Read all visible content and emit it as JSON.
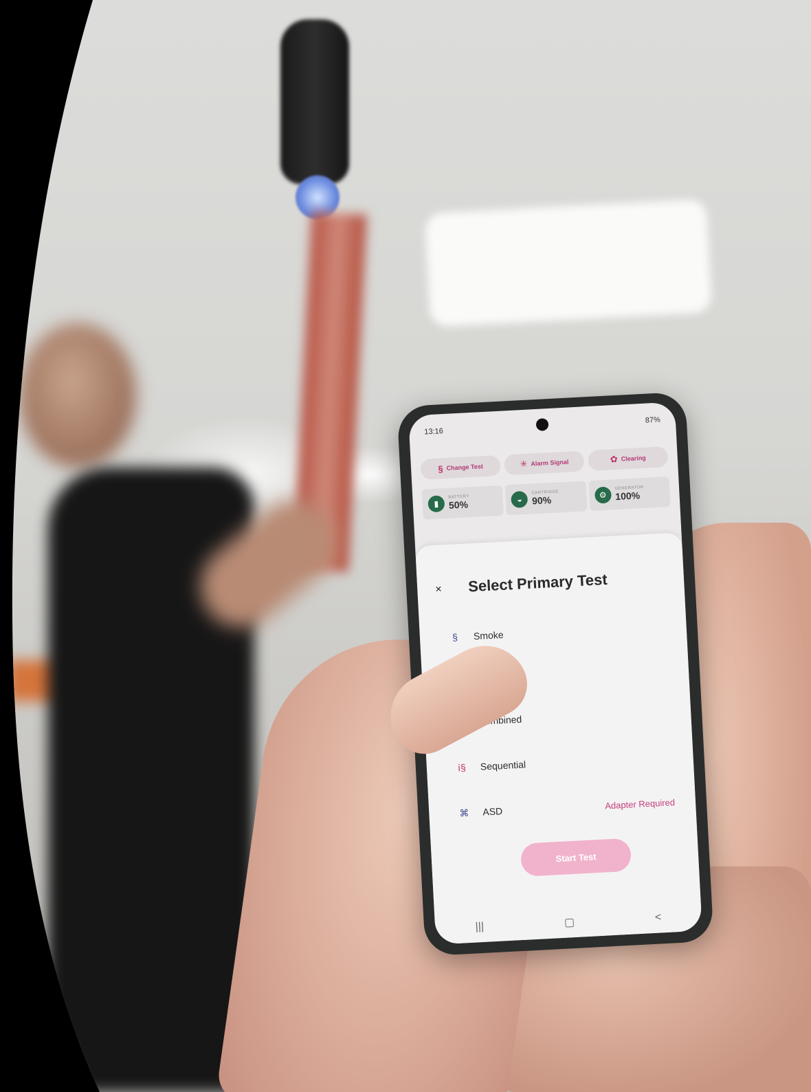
{
  "phone": {
    "status": {
      "time": "13:16",
      "battery": "87%"
    },
    "chips": [
      {
        "label": "Change Test",
        "icon": "smoke-icon"
      },
      {
        "label": "Alarm Signal",
        "icon": "alarm-icon"
      },
      {
        "label": "Clearing",
        "icon": "fan-icon"
      }
    ],
    "stats": [
      {
        "label": "BATTERY",
        "value": "50%"
      },
      {
        "label": "CARTRIDGE",
        "value": "90%"
      },
      {
        "label": "GENERATOR",
        "value": "100%"
      }
    ],
    "sheet": {
      "title": "Select Primary Test",
      "close": "×",
      "options": [
        {
          "label": "Smoke",
          "icon": "smoke-icon"
        },
        {
          "label": "Combined",
          "icon": "combined-icon"
        },
        {
          "label": "Sequential",
          "icon": "sequential-icon"
        },
        {
          "label": "ASD",
          "icon": "asd-icon",
          "badge": "Adapter Required"
        }
      ],
      "start_button": "Start Test"
    },
    "navbar": {
      "recent": "|||",
      "home": "▢",
      "back": "<"
    }
  },
  "colors": {
    "accent": "#c2407e",
    "button": "#f1b3cc",
    "stat_icon": "#276b4a"
  }
}
